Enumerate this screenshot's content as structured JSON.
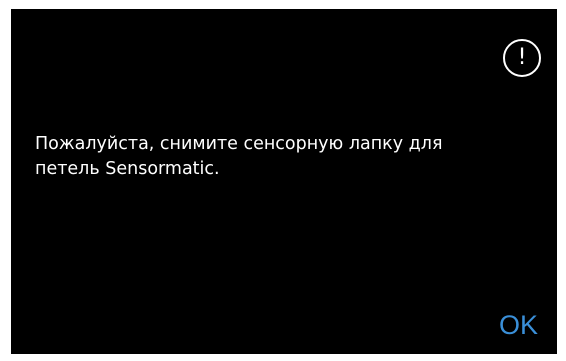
{
  "dialog": {
    "icon": "exclamation-circle-icon",
    "icon_glyph": "!",
    "message": "Пожалуйста, снимите сенсорную лапку для\nпетель Sensormatic.",
    "ok_label": "OK",
    "colors": {
      "background": "#000000",
      "text": "#ffffff",
      "accent": "#3a8fd8"
    }
  }
}
